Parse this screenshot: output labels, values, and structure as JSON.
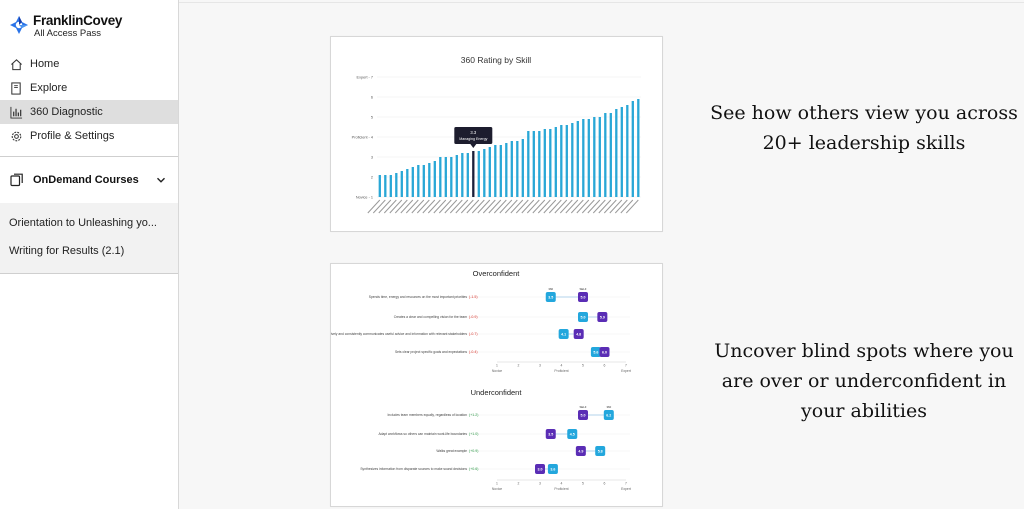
{
  "brand": {
    "name": "FranklinCovey",
    "subtitle": "All Access Pass"
  },
  "nav": [
    {
      "label": "Home",
      "icon": "home-icon"
    },
    {
      "label": "Explore",
      "icon": "book-icon"
    },
    {
      "label": "360 Diagnostic",
      "icon": "bar-chart-icon",
      "active": true
    },
    {
      "label": "Profile & Settings",
      "icon": "gear-icon"
    }
  ],
  "ondemand": {
    "label": "OnDemand Courses",
    "courses": [
      "Orientation to Unleashing yo...",
      "Writing for Results (2.1)"
    ]
  },
  "captions": {
    "first": "See how others view you across 20+ leadership skills",
    "second": "Uncover blind spots where you are over or underconfident in your abilities"
  },
  "chart_data": [
    {
      "type": "bar",
      "title": "360 Rating by Skill",
      "y_tick_labels": [
        "Expert - 7",
        "6",
        "5",
        "Proficient - 4",
        "3",
        "2",
        "Novice - 1"
      ],
      "ylim": [
        1,
        7
      ],
      "values": [
        2.1,
        2.1,
        2.1,
        2.2,
        2.3,
        2.4,
        2.5,
        2.6,
        2.6,
        2.7,
        2.8,
        3.0,
        3.0,
        3.0,
        3.1,
        3.2,
        3.2,
        3.3,
        3.3,
        3.4,
        3.5,
        3.6,
        3.6,
        3.7,
        3.8,
        3.8,
        3.9,
        4.3,
        4.3,
        4.3,
        4.4,
        4.4,
        4.5,
        4.6,
        4.6,
        4.7,
        4.8,
        4.9,
        4.9,
        5.0,
        5.0,
        5.2,
        5.2,
        5.4,
        5.5,
        5.6,
        5.8,
        5.9
      ],
      "tooltip": {
        "value": "3.3",
        "label": "Managing Energy"
      },
      "highlight_index": 17,
      "color": "#29a7d6",
      "highlight_color": "#1a1f3a"
    },
    {
      "type": "scatter",
      "title": "Overconfident",
      "x_ticks": [
        "1",
        "2",
        "3",
        "4",
        "5",
        "6",
        "7"
      ],
      "x_axis_labels": [
        "Novice",
        "Proficient",
        "Expert"
      ],
      "rows": [
        {
          "label": "Spends time, energy and resources on the most important priorities",
          "delta": "(-1.5)",
          "self": 5.0,
          "others": 3.5,
          "self_top_label": "SELF",
          "others_top_label": "360"
        },
        {
          "label": "Creates a clear and compelling vision for the team",
          "delta": "(-0.9)",
          "self": 5.9,
          "others": 5.0
        },
        {
          "label": "Proactively and consistently communicates useful advice and information with relevant stakeholders",
          "delta": "(-0.7)",
          "self": 4.8,
          "others": 4.1
        },
        {
          "label": "Sets clear project specific goals and expectations",
          "delta": "(-0.4)",
          "self": 6.0,
          "others": 5.6
        }
      ],
      "delta_color": "#d9342b"
    },
    {
      "type": "scatter",
      "title": "Underconfident",
      "x_ticks": [
        "1",
        "2",
        "3",
        "4",
        "5",
        "6",
        "7"
      ],
      "x_axis_labels": [
        "Novice",
        "Proficient",
        "Expert"
      ],
      "rows": [
        {
          "label": "Includes team members equally, regardless of location",
          "delta": "(+1.2)",
          "self": 5.0,
          "others": 6.2,
          "self_top_label": "SELF",
          "others_top_label": "360"
        },
        {
          "label": "Adapt workflows so others can maintain work-life boundaries",
          "delta": "(+1.0)",
          "self": 3.5,
          "others": 4.5
        },
        {
          "label": "Walks great example",
          "delta": "(+0.9)",
          "self": 4.9,
          "others": 5.8
        },
        {
          "label": "Synthesizes information from disparate sources to make sound decisions",
          "delta": "(+0.6)",
          "self": 3.0,
          "others": 3.6
        }
      ],
      "delta_color": "#2e9a48"
    }
  ],
  "colors": {
    "self": "#5a2db5",
    "others": "#23a7dd"
  }
}
